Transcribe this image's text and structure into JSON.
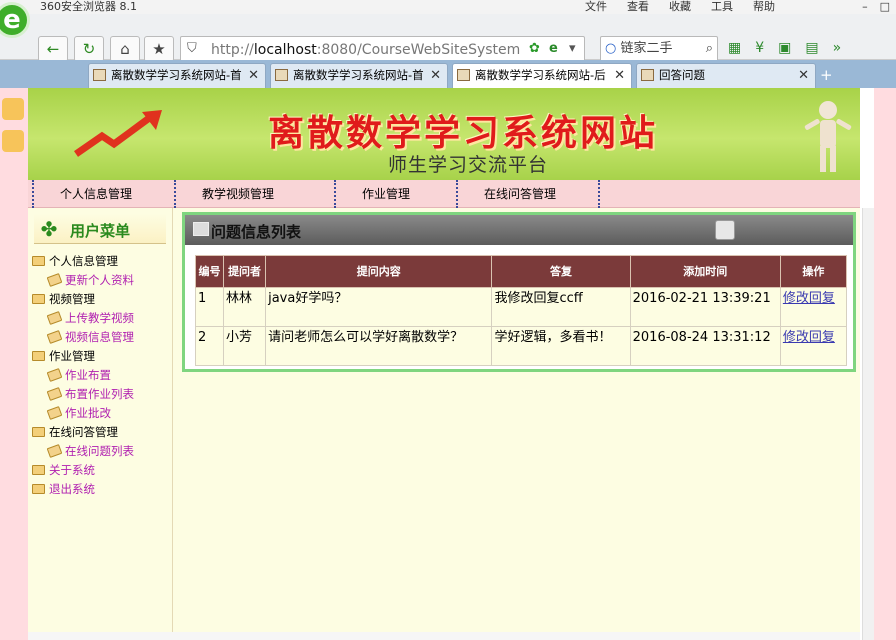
{
  "browser": {
    "app_name": "360安全浏览器 8.1",
    "menus": [
      "文件",
      "查看",
      "收藏",
      "工具",
      "帮助"
    ],
    "address": {
      "prefix": "http://",
      "host": "localhost",
      "rest": ":8080/CourseWebSiteSystem"
    },
    "search_placeholder": "链家二手",
    "tabs": [
      {
        "label": "离散数学学习系统网站-首"
      },
      {
        "label": "离散数学学习系统网站-首"
      },
      {
        "label": "离散数学学习系统网站-后"
      },
      {
        "label": "回答问题"
      }
    ]
  },
  "banner": {
    "title": "离散数学学习系统网站",
    "subtitle": "师生学习交流平台"
  },
  "nav": {
    "items": [
      "个人信息管理",
      "教学视频管理",
      "作业管理",
      "在线问答管理"
    ]
  },
  "sidebar": {
    "title": "用户菜单",
    "tree": [
      {
        "label": "个人信息管理",
        "level": 1
      },
      {
        "label": "更新个人资料",
        "level": 2
      },
      {
        "label": "视频管理",
        "level": 1
      },
      {
        "label": "上传教学视频",
        "level": 2
      },
      {
        "label": "视频信息管理",
        "level": 2
      },
      {
        "label": "作业管理",
        "level": 1
      },
      {
        "label": "作业布置",
        "level": 2
      },
      {
        "label": "布置作业列表",
        "level": 2
      },
      {
        "label": "作业批改",
        "level": 2
      },
      {
        "label": "在线问答管理",
        "level": 1
      },
      {
        "label": "在线问题列表",
        "level": 2
      },
      {
        "label": "关于系统",
        "level": 1
      },
      {
        "label": "退出系统",
        "level": 1
      }
    ]
  },
  "panel": {
    "title": "问题信息列表",
    "columns": [
      "编号",
      "提问者",
      "提问内容",
      "答复",
      "添加时间",
      "操作"
    ],
    "rows": [
      {
        "id": "1",
        "asker": "林林",
        "question": "java好学吗？",
        "answer": "我修改回复ccff",
        "time": "2016-02-21 13:39:21",
        "action": "修改回复"
      },
      {
        "id": "2",
        "asker": "小芳",
        "question": "请问老师怎么可以学好离散数学？",
        "answer": "学好逻辑，多看书！",
        "time": "2016-08-24 13:31:12",
        "action": "修改回复"
      }
    ]
  }
}
